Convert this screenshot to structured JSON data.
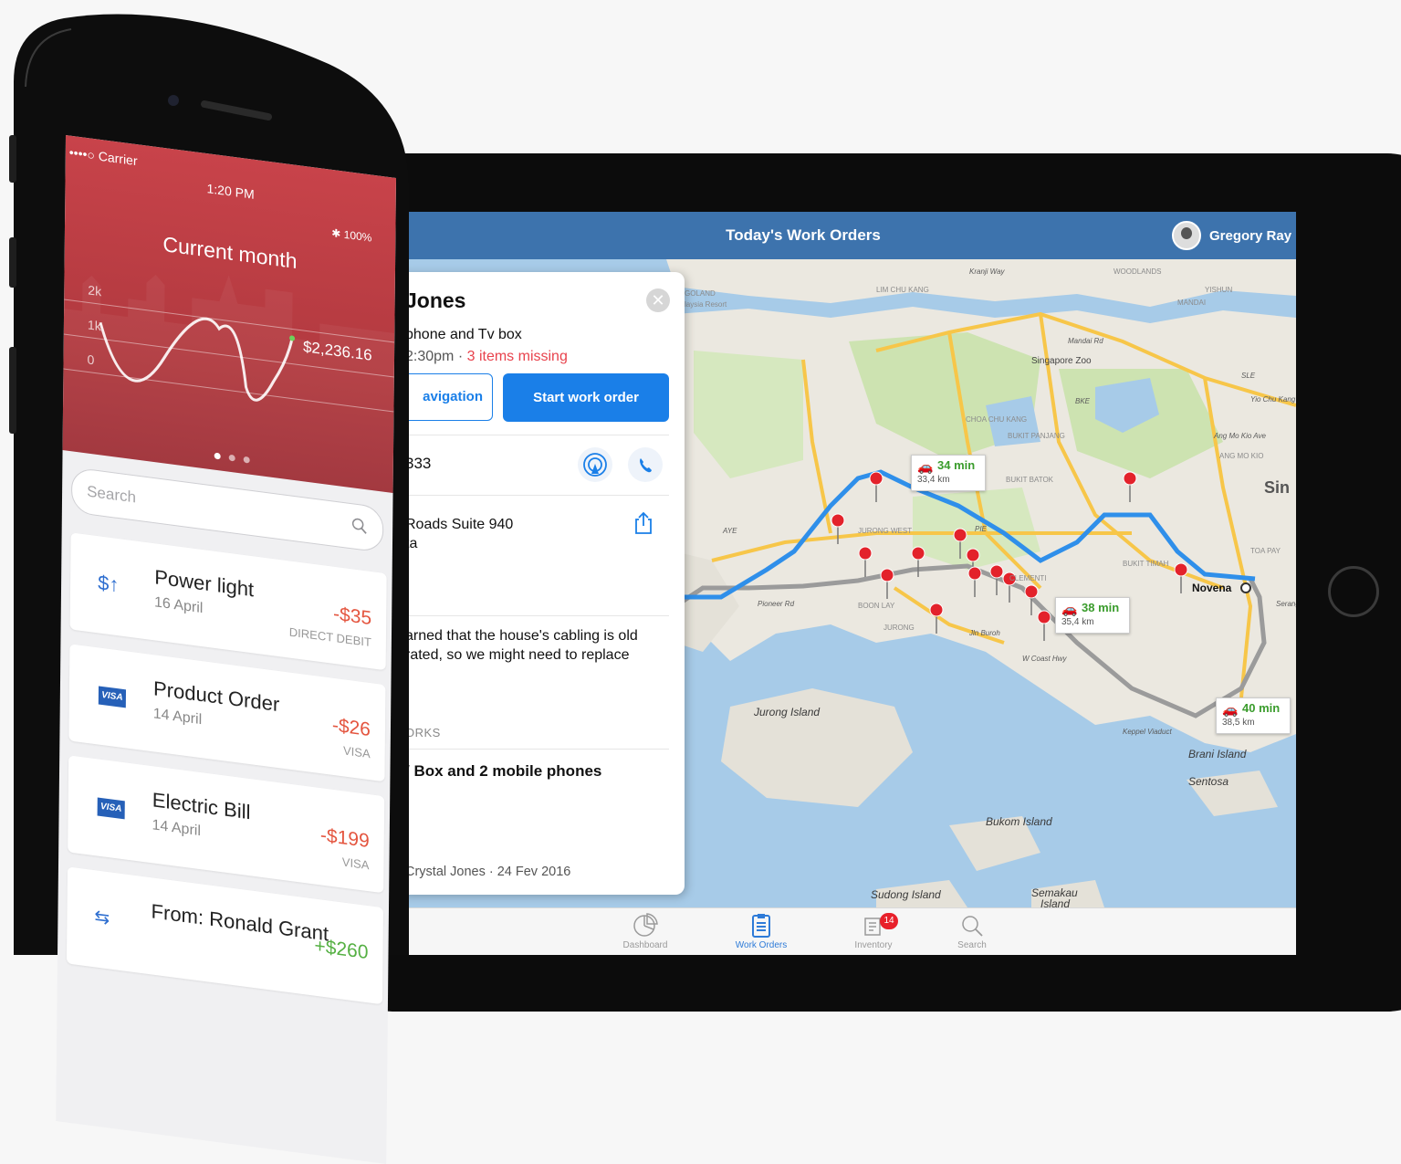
{
  "ipad": {
    "nav_title": "Today's Work Orders",
    "user_name": "Gregory Ray",
    "card": {
      "close_glyph": "✕",
      "customer_name": "Jones",
      "subtitle": "phone and Tv box",
      "time": "2:30pm · ",
      "missing": "3 items missing",
      "navigation_button": "avigation",
      "start_button": "Start work order",
      "phone": "333",
      "address": "Roads Suite 940\nta",
      "notes": "arned that the house's cabling is old\nrated, so we might need to replace",
      "section_label": "ORKS",
      "item": "/ Box and 2 mobile phones",
      "footer": "Crystal Jones · 24 Fev 2016"
    },
    "map": {
      "labels": [
        {
          "text": "GOLAND",
          "kind": "area"
        },
        {
          "text": "laysia Resort",
          "kind": "area"
        },
        {
          "text": "Kranji Way",
          "kind": "road"
        },
        {
          "text": "WOODLANDS",
          "kind": "area"
        },
        {
          "text": "LIM CHU KANG",
          "kind": "area"
        },
        {
          "text": "YISHUN",
          "kind": "area"
        },
        {
          "text": "MANDAI",
          "kind": "area"
        },
        {
          "text": "Mandai Rd",
          "kind": "road"
        },
        {
          "text": "Singapore Zoo",
          "kind": "poi"
        },
        {
          "text": "SLE",
          "kind": "road"
        },
        {
          "text": "BKE",
          "kind": "road"
        },
        {
          "text": "Yio Chu Kang",
          "kind": "road"
        },
        {
          "text": "Ang Mo Kio Ave",
          "kind": "road"
        },
        {
          "text": "ANG MO KIO",
          "kind": "area"
        },
        {
          "text": "CHOA CHU KANG",
          "kind": "area"
        },
        {
          "text": "BUKIT PANJANG",
          "kind": "area"
        },
        {
          "text": "BUKIT BATOK",
          "kind": "area"
        },
        {
          "text": "JURONG WEST",
          "kind": "area"
        },
        {
          "text": "PIE",
          "kind": "road"
        },
        {
          "text": "BUKIT TIMAH",
          "kind": "area"
        },
        {
          "text": "TOA PAY",
          "kind": "area"
        },
        {
          "text": "Sin",
          "kind": "big"
        },
        {
          "text": "AYE",
          "kind": "road"
        },
        {
          "text": "Pioneer Rd",
          "kind": "road"
        },
        {
          "text": "BOON LAY",
          "kind": "area"
        },
        {
          "text": "JURONG",
          "kind": "area"
        },
        {
          "text": "Jln Buroh",
          "kind": "road"
        },
        {
          "text": "W Coast Hwy",
          "kind": "road"
        },
        {
          "text": "CLEMENTI",
          "kind": "area"
        },
        {
          "text": "Novena",
          "kind": "place"
        },
        {
          "text": "Jurong Island",
          "kind": "island"
        },
        {
          "text": "Keppel Viaduct",
          "kind": "road"
        },
        {
          "text": "Brani Island",
          "kind": "island"
        },
        {
          "text": "Sentosa",
          "kind": "island"
        },
        {
          "text": "Bukom Island",
          "kind": "island"
        },
        {
          "text": "Sudong Island",
          "kind": "island"
        },
        {
          "text": "Semakau",
          "kind": "island"
        },
        {
          "text": "Island",
          "kind": "island"
        },
        {
          "text": "Serangoon",
          "kind": "road"
        }
      ],
      "route_callouts": [
        {
          "time": "34 min",
          "distance": "33,4 km"
        },
        {
          "time": "38 min",
          "distance": "35,4 km"
        },
        {
          "time": "40 min",
          "distance": "38,5 km"
        }
      ],
      "colors": {
        "water": "#a7cbe8",
        "land": "#ebe8e0",
        "green": "#cde3b1",
        "main_route": "#2f8fea",
        "alt_route": "#9b9b9b",
        "highway": "#f7c649",
        "pin": "#e3222b"
      }
    },
    "tabs": [
      {
        "label": "Dashboard",
        "icon": "pie-chart-icon",
        "active": false
      },
      {
        "label": "Work Orders",
        "icon": "clipboard-icon",
        "active": true
      },
      {
        "label": "Inventory",
        "icon": "inventory-icon",
        "active": false,
        "badge": "14"
      },
      {
        "label": "Search",
        "icon": "search-icon",
        "active": false
      }
    ]
  },
  "phone": {
    "carrier": "••••○ Carrier",
    "time": "1:20 PM",
    "battery": "✱ 100%",
    "heading": "Current month",
    "chart_axis": [
      "2k",
      "1k",
      "0"
    ],
    "current_amount": "$2,236.16",
    "search_placeholder": "Search",
    "transactions": [
      {
        "title": "Power light",
        "date": "16 April",
        "amount": "-$35",
        "method": "DIRECT DEBIT",
        "icon": "transfer-out-icon"
      },
      {
        "title": "Product Order",
        "date": "14 April",
        "amount": "-$26",
        "method": "VISA",
        "icon": "visa-icon"
      },
      {
        "title": "Electric Bill",
        "date": "14 April",
        "amount": "-$199",
        "method": "VISA",
        "icon": "visa-icon"
      },
      {
        "title": "From: Ronald Grant",
        "date": "",
        "amount": "+$260",
        "method": "",
        "icon": "transfer-icon"
      }
    ],
    "colors": {
      "hero": "#c8434a",
      "expense": "#e4553f",
      "income": "#55b043"
    }
  }
}
